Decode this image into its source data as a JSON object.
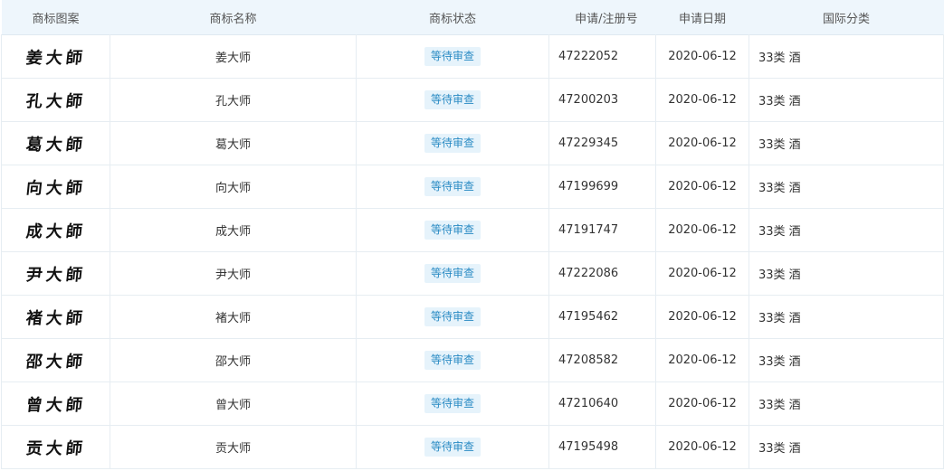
{
  "headers": {
    "image": "商标图案",
    "name": "商标名称",
    "status": "商标状态",
    "reg_no": "申请/注册号",
    "date": "申请日期",
    "class": "国际分类"
  },
  "rows": [
    {
      "mark_text": "姜大師",
      "name": "姜大师",
      "status": "等待审查",
      "reg_no": "47222052",
      "date": "2020-06-12",
      "class": "33类 酒"
    },
    {
      "mark_text": "孔大師",
      "name": "孔大师",
      "status": "等待审查",
      "reg_no": "47200203",
      "date": "2020-06-12",
      "class": "33类 酒"
    },
    {
      "mark_text": "葛大師",
      "name": "葛大师",
      "status": "等待审查",
      "reg_no": "47229345",
      "date": "2020-06-12",
      "class": "33类 酒"
    },
    {
      "mark_text": "向大師",
      "name": "向大师",
      "status": "等待审查",
      "reg_no": "47199699",
      "date": "2020-06-12",
      "class": "33类 酒"
    },
    {
      "mark_text": "成大師",
      "name": "成大师",
      "status": "等待审查",
      "reg_no": "47191747",
      "date": "2020-06-12",
      "class": "33类 酒"
    },
    {
      "mark_text": "尹大師",
      "name": "尹大师",
      "status": "等待审查",
      "reg_no": "47222086",
      "date": "2020-06-12",
      "class": "33类 酒"
    },
    {
      "mark_text": "褚大師",
      "name": "褚大师",
      "status": "等待审查",
      "reg_no": "47195462",
      "date": "2020-06-12",
      "class": "33类 酒"
    },
    {
      "mark_text": "邵大師",
      "name": "邵大师",
      "status": "等待审查",
      "reg_no": "47208582",
      "date": "2020-06-12",
      "class": "33类 酒"
    },
    {
      "mark_text": "曾大師",
      "name": "曾大师",
      "status": "等待审查",
      "reg_no": "47210640",
      "date": "2020-06-12",
      "class": "33类 酒"
    },
    {
      "mark_text": "贡大師",
      "name": "贡大师",
      "status": "等待审查",
      "reg_no": "47195498",
      "date": "2020-06-12",
      "class": "33类 酒"
    }
  ]
}
